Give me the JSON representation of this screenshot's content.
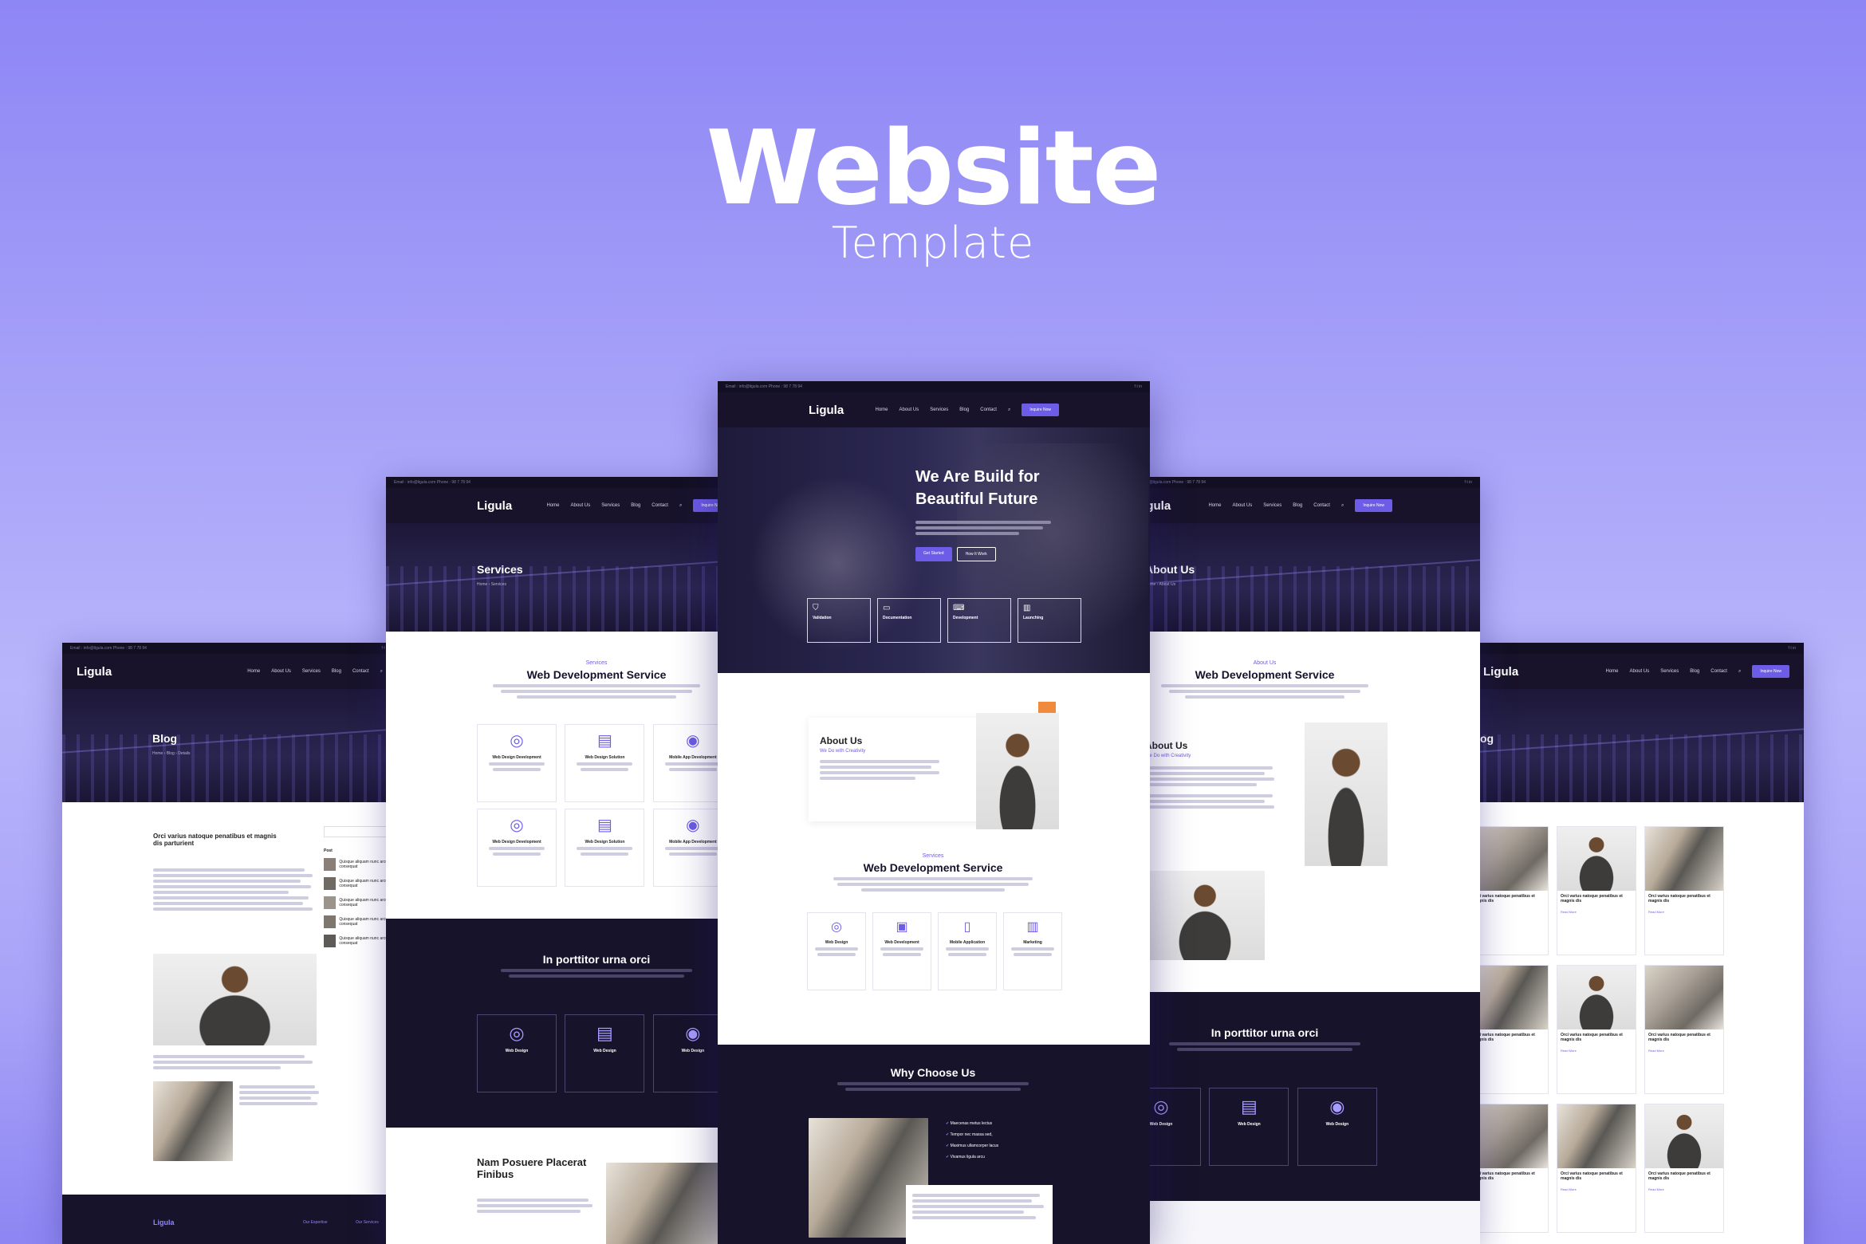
{
  "hero": {
    "title": "Website",
    "subtitle": "Template"
  },
  "site": {
    "logo": "Ligula",
    "nav": [
      "Home",
      "About Us",
      "Services",
      "Blog",
      "Contact"
    ],
    "nav_button": "Inquire Now",
    "topbar_left": "Email : info@ligula.com     Phone : 98 7 78 94",
    "accent_color": "#6c5ce7",
    "dark_color": "#17132a"
  },
  "center": {
    "hero_title_1": "We Are Build for",
    "hero_title_2": "Beautiful Future",
    "btn_primary": "Get Started",
    "btn_secondary": "How It Work",
    "features": [
      "Validation",
      "Documentation",
      "Development",
      "Launching"
    ],
    "about_title": "About Us",
    "about_sub": "We Do with Creativity",
    "services_kicker": "Services",
    "services_title": "Web Development Service",
    "services": [
      "Web Design",
      "Web Development",
      "Mobile Application",
      "Marketing"
    ],
    "why_title": "Why Choose Us",
    "why_points": [
      "Maecenas metus lectus",
      "Tempor nec massa sed,",
      "Maximus ullamcorper lacus",
      "Vivamus ligula arcu"
    ]
  },
  "left2": {
    "banner_title": "Services",
    "crumb": "Home  ›  Services",
    "kicker": "Services",
    "title": "Web Development Service",
    "cards": [
      "Web Design Development",
      "Web Design Solution",
      "Mobile App Development",
      "Web Design Development",
      "Web Design Solution",
      "Mobile App Development"
    ],
    "dark_title": "In porttitor urna orci",
    "dark_cards": [
      "Web Design",
      "Web Design",
      "Web Design"
    ],
    "bottom_title_1": "Nam Posuere Placerat",
    "bottom_title_2": "Finibus"
  },
  "left1": {
    "banner_title": "Blog",
    "crumb": "Home  ›  Blog  ›  Details",
    "post_title_1": "Orci varius natoque penatibus et magnis",
    "post_title_2": "dis parturient",
    "sidebar_heading": "Post",
    "sidebar_posts": [
      "Quisque aliquam nunc arcu consequat",
      "Quisque aliquam nunc arcu consequat",
      "Quisque aliquam nunc arcu consequat",
      "Quisque aliquam nunc arcu consequat",
      "Quisque aliquam nunc arcu consequat"
    ],
    "footer_logo": "Ligula",
    "footer_col1": "Our Expertise",
    "footer_col2": "Our Services"
  },
  "right2": {
    "banner_title": "About Us",
    "crumb": "Home  ›  About Us",
    "kicker": "About Us",
    "title": "Web Development Service",
    "about_title": "About Us",
    "about_sub": "We Do with Creativity",
    "dark_title": "In porttitor urna orci",
    "dark_cards": [
      "Web Design",
      "Web Design",
      "Web Design"
    ]
  },
  "right1": {
    "banner_title": "Blog",
    "card_title": "Orci varius natoque penatibus et magnis dis",
    "read_more": "Read More"
  }
}
